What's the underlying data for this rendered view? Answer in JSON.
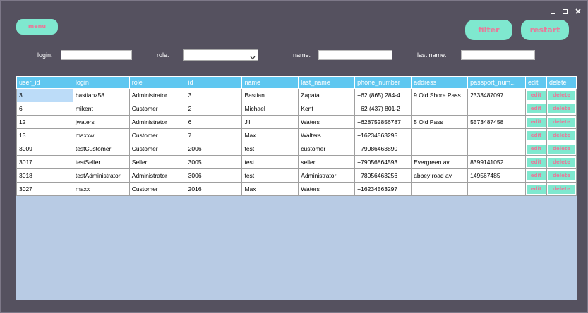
{
  "toolbar": {
    "menu_label": "menu",
    "filter_label": "filter",
    "restart_label": "restart"
  },
  "filters": {
    "login_label": "login:",
    "login_value": "",
    "role_label": "role:",
    "role_value": "",
    "name_label": "name:",
    "name_value": "",
    "last_name_label": "last name:",
    "last_name_value": ""
  },
  "table": {
    "columns": [
      "user_id",
      "login",
      "role",
      "id",
      "name",
      "last_name",
      "phone_number",
      "address",
      "passport_num...",
      "edit",
      "delete"
    ],
    "edit_label": "edit",
    "delete_label": "delete",
    "rows": [
      [
        "3",
        "bastianz58",
        "Administrator",
        "3",
        "Bastian",
        "Zapata",
        "+62 (865) 284-4",
        "9 Old Shore Pass",
        "2333487097"
      ],
      [
        "6",
        "mikent",
        "Customer",
        "2",
        "Michael",
        "Kent",
        "+62 (437) 801-2",
        "",
        ""
      ],
      [
        "12",
        "jwaters",
        "Administrator",
        "6",
        "Jill",
        "Waters",
        "+628752856787",
        "5 Old Pass",
        "5573487458"
      ],
      [
        "13",
        "maxxw",
        "Customer",
        "7",
        "Max",
        "Walters",
        "+16234563295",
        "",
        ""
      ],
      [
        "3009",
        "testCustomer",
        "Customer",
        "2006",
        "test",
        "customer",
        "+79086463890",
        "",
        ""
      ],
      [
        "3017",
        "testSeller",
        "Seller",
        "3005",
        "test",
        "seller",
        "+79056864593",
        "Evergreen av",
        "8399141052"
      ],
      [
        "3018",
        "testAdministrator",
        "Administrator",
        "3006",
        "test",
        "Administrator",
        "+78056463256",
        "abbey road av",
        "149567485"
      ],
      [
        "3027",
        "maxx",
        "Customer",
        "2016",
        "Max",
        "Waters",
        "+16234563297",
        "",
        ""
      ]
    ]
  },
  "colors": {
    "background": "#55515f",
    "accent_button": "#7fe8cf",
    "button_text": "#e87a9a",
    "header": "#5fc7f0",
    "grid_empty": "#b8cbe4",
    "selected_cell": "#bcdcf8"
  },
  "icons": [
    "minimize-icon",
    "maximize-icon",
    "close-icon",
    "chevron-down-icon"
  ]
}
